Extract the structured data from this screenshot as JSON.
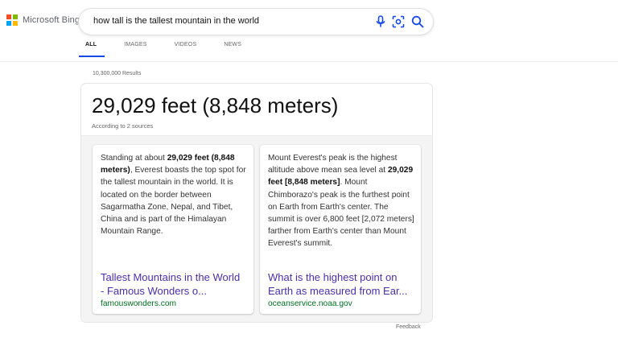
{
  "brand": {
    "name": "Microsoft Bing",
    "colors": [
      "#f25022",
      "#7fba00",
      "#00a4ef",
      "#ffb900"
    ]
  },
  "search": {
    "query": "how tall is the tallest mountain in the world",
    "icons": [
      "microphone-icon",
      "visual-search-icon",
      "search-icon"
    ],
    "accent": "#174ae4"
  },
  "tabs": [
    {
      "label": "ALL",
      "active": true
    },
    {
      "label": "IMAGES",
      "active": false
    },
    {
      "label": "VIDEOS",
      "active": false
    },
    {
      "label": "NEWS",
      "active": false
    }
  ],
  "results": {
    "count": "10,300,000 Results"
  },
  "answer": {
    "title": "29,029 feet (8,848 meters)",
    "sources_label": "According to 2 sources",
    "cards": [
      {
        "text_parts": [
          {
            "text": "Standing at about ",
            "bold": false
          },
          {
            "text": "29,029 feet (8,848 meters)",
            "bold": true
          },
          {
            "text": ", Everest boasts the top spot for the tallest mountain in the world. It is located on the border between Sagarmatha Zone, Nepal, and Tibet, China and is part of the Himalayan Mountain Range.",
            "bold": false
          }
        ],
        "link_text": "Tallest Mountains in the World - Famous Wonders o...",
        "url": "famouswonders.com"
      },
      {
        "text_parts": [
          {
            "text": "Mount Everest's peak is the highest altitude above mean sea level at ",
            "bold": false
          },
          {
            "text": "29,029 feet [8,848 meters]",
            "bold": true
          },
          {
            "text": ". Mount Chimborazo's peak is the furthest point on Earth from Earth's center. The summit is over 6,800 feet [2,072 meters] farther from Earth's center than Mount Everest's summit.",
            "bold": false
          }
        ],
        "link_text": "What is the highest point on Earth as measured from Ear...",
        "url": "oceanservice.noaa.gov"
      }
    ]
  },
  "footer": {
    "feedback": "Feedback"
  }
}
